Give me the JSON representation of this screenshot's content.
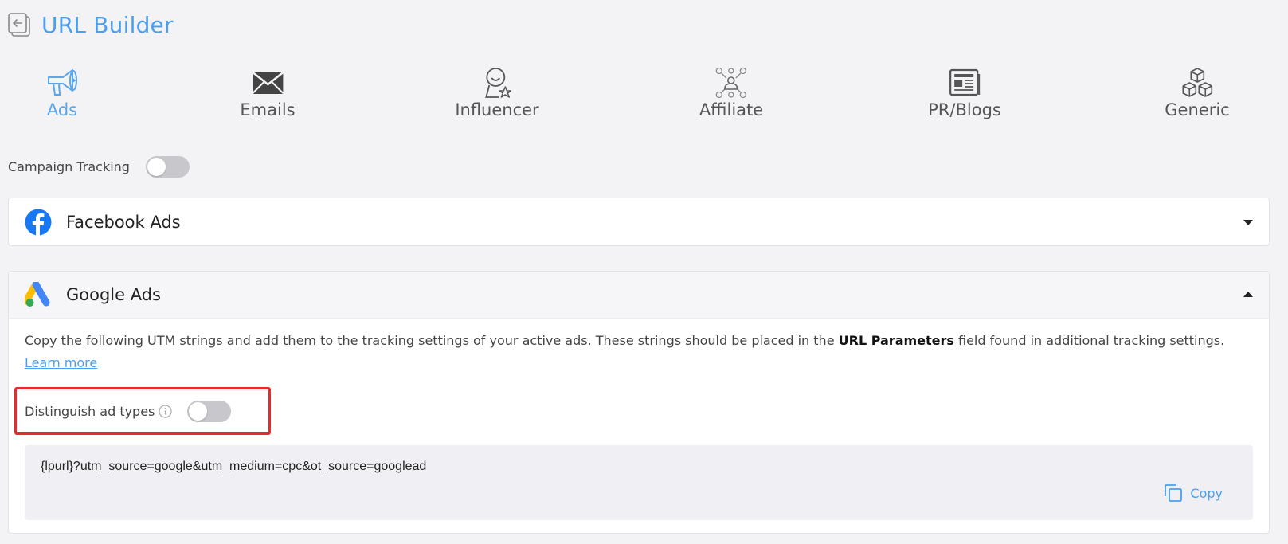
{
  "header": {
    "title": "URL Builder"
  },
  "categories": [
    {
      "label": "Ads",
      "icon": "megaphone-icon",
      "active": true
    },
    {
      "label": "Emails",
      "icon": "envelope-icon",
      "active": false
    },
    {
      "label": "Influencer",
      "icon": "influencer-icon",
      "active": false
    },
    {
      "label": "Affiliate",
      "icon": "affiliate-network-icon",
      "active": false
    },
    {
      "label": "PR/Blogs",
      "icon": "newspaper-icon",
      "active": false
    },
    {
      "label": "Generic",
      "icon": "cubes-icon",
      "active": false
    }
  ],
  "campaign_tracking": {
    "label": "Campaign Tracking",
    "enabled": false
  },
  "facebook": {
    "title": "Facebook Ads",
    "expanded": false
  },
  "google": {
    "title": "Google Ads",
    "expanded": true,
    "desc_before": "Copy the following UTM strings and add them to the tracking settings of your active ads. These strings should be placed in the ",
    "desc_bold": "URL Parameters",
    "desc_after": " field found in additional tracking settings. ",
    "learn_more": "Learn more",
    "distinguish_label": "Distinguish ad types",
    "distinguish_enabled": false,
    "utm_string": "{lpurl}?utm_source=google&utm_medium=cpc&ot_source=googlead",
    "copy_label": "Copy"
  },
  "colors": {
    "accent": "#4a9ff0",
    "highlight": "#ea2a2a",
    "facebook": "#1877f2"
  }
}
